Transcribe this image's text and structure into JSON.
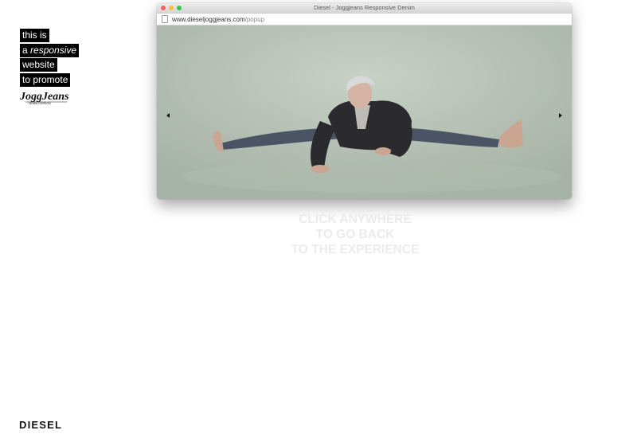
{
  "tagline": {
    "line1": "this is",
    "line2_prefix": "a",
    "line2_emph": "responsive",
    "line3": "website",
    "line4": "to promote"
  },
  "jogg_logo": {
    "name": "JoggJeans",
    "sub": "DENIM DIVISION"
  },
  "browser": {
    "title": "Diesel - Joggjeans Responsive Denim",
    "url_domain": "www.dieseljoggjeans.com",
    "url_path": "/popup"
  },
  "photo": {
    "icon": "model-in-splits-photo"
  },
  "cta": {
    "line1": "CLICK ANYWHERE",
    "line2": "TO GO BACK",
    "line3": "TO THE EXPERIENCE"
  },
  "footer": {
    "brand": "DIESEL"
  }
}
